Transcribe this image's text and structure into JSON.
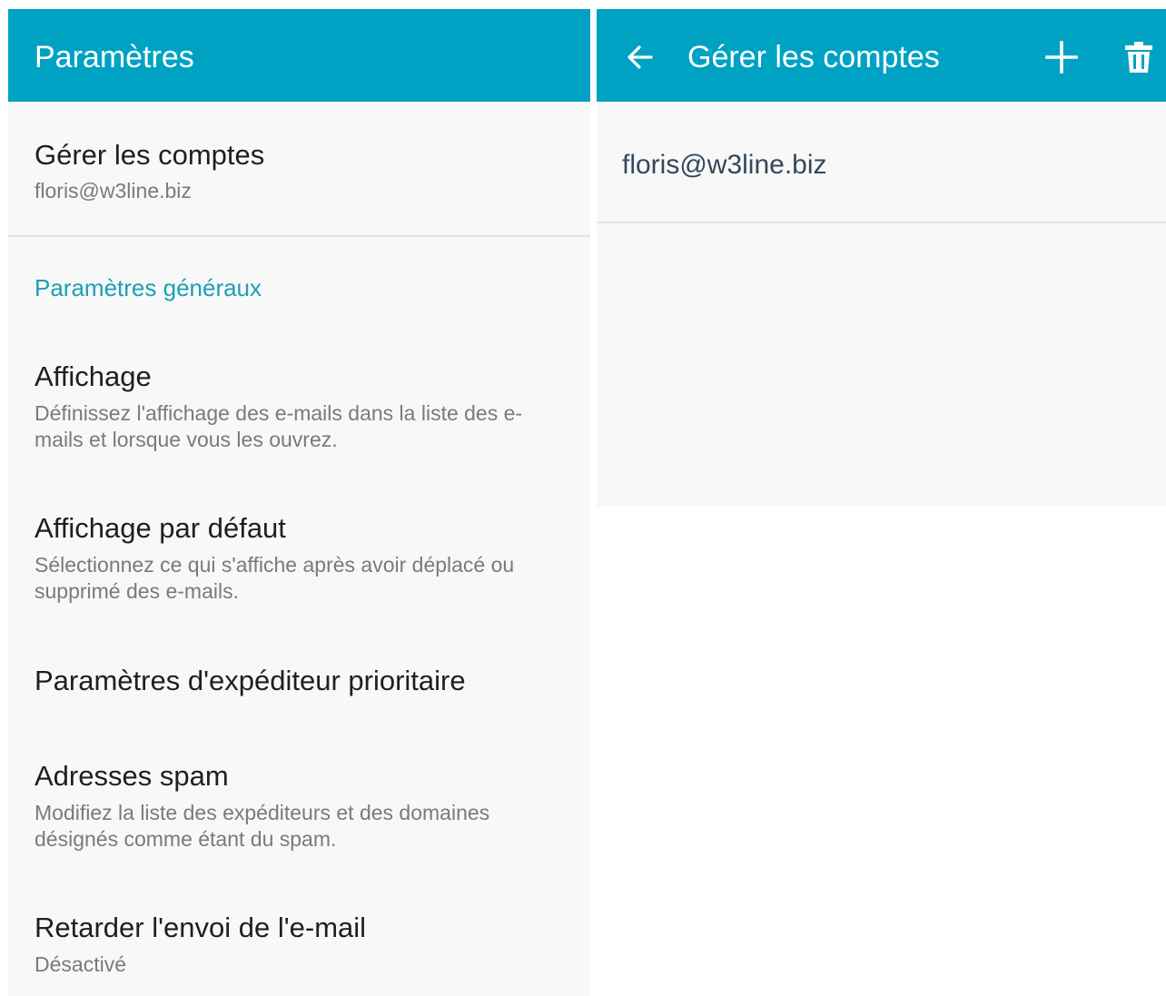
{
  "settings": {
    "title": "Paramètres",
    "manage_accounts": {
      "title": "Gérer les comptes",
      "subtitle": "floris@w3line.biz"
    },
    "section_header": "Paramètres généraux",
    "items": [
      {
        "title": "Affichage",
        "subtitle": "Définissez l'affichage des e-mails dans la liste des e-mails et lorsque vous les ouvrez."
      },
      {
        "title": "Affichage par défaut",
        "subtitle": "Sélectionnez ce qui s'affiche après avoir déplacé ou supprimé des e-mails."
      },
      {
        "title": "Paramètres d'expéditeur prioritaire",
        "subtitle": ""
      },
      {
        "title": "Adresses spam",
        "subtitle": "Modifiez la liste des expéditeurs et des domaines désignés comme étant du spam."
      },
      {
        "title": "Retarder l'envoi de l'e-mail",
        "subtitle": "Désactivé"
      }
    ]
  },
  "manage_accounts": {
    "title": "Gérer les comptes",
    "accounts": [
      "floris@w3line.biz"
    ]
  },
  "icons": {
    "back": "arrow-left-icon",
    "add": "plus-icon",
    "delete": "trash-icon"
  },
  "colors": {
    "appbar": "#00a2c4",
    "section_header": "#1aa0b4",
    "background": "#f8f8f8"
  }
}
